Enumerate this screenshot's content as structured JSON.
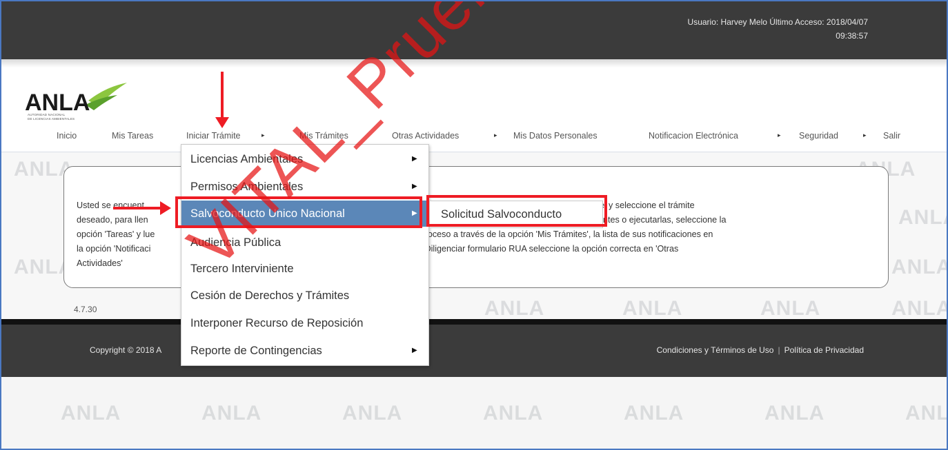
{
  "header": {
    "user_label": "Usuario: Harvey Melo  Último Acceso:  2018/04/07",
    "time": "09:38:57",
    "logo_text": "ANLA",
    "logo_sub_1": "AUTORIDAD NACIONAL",
    "logo_sub_2": "DE LICENCIAS AMBIENTALES"
  },
  "nav": {
    "inicio": "Inicio",
    "mis_tareas": "Mis Tareas",
    "iniciar_tramite": "Iniciar Trámite",
    "mis_tramites": "Mis Trámites",
    "otras_actividades": "Otras Actividades",
    "mis_datos": "Mis Datos Personales",
    "notificacion": "Notificacion Electrónica",
    "seguridad": "Seguridad",
    "salir": "Salir",
    "submenu_arrow": "▸"
  },
  "dropdown": {
    "items": [
      {
        "label": "Licencias Ambientales",
        "has_submenu": true
      },
      {
        "label": "Permisos Ambientales",
        "has_submenu": true
      },
      {
        "label": "Salvoconducto Unico Nacional",
        "has_submenu": true
      },
      {
        "label": "Audiencia Pública",
        "has_submenu": false
      },
      {
        "label": "Tercero Interviniente",
        "has_submenu": false
      },
      {
        "label": "Cesión de Derechos y Trámites",
        "has_submenu": false
      },
      {
        "label": "Interponer Recurso de Reposición",
        "has_submenu": false
      },
      {
        "label": "Reporte de Contingencias",
        "has_submenu": true
      }
    ],
    "caret": "▶",
    "submenu_item": "Solicitud Salvoconducto"
  },
  "message": {
    "line1a": "Usted se encuent",
    "line1b": "pción 'Iniciar Trámite' y seleccione el trámite",
    "line2a": "deseado, para llen",
    "line2b": "actividades pendientes o ejecutarlas, seleccione la",
    "line3a": "opción 'Tareas' y lue",
    "line3b": "es en proceso a través de la opción 'Mis Trámites', la lista de sus notificaciones en",
    "line4a": "la opción 'Notificaci",
    "line4b": "nsultar, Diligenciar formulario RUA seleccione la opción correcta en 'Otras",
    "line5": "Actividades'"
  },
  "version": "4.7.30",
  "footer": {
    "copyright": "Copyright © 2018 A",
    "terms": "Condiciones y Términos de Uso",
    "separator": "|",
    "privacy": "Política de Privacidad"
  },
  "watermark": {
    "tile_text": "ANLA",
    "overlay_text": "VITAL_Pruebas"
  },
  "colors": {
    "topbar": "#3b3b3b",
    "menu_active": "#5b87b8",
    "annotation_red": "#ee1c24",
    "frame_border": "#4a78c2"
  }
}
